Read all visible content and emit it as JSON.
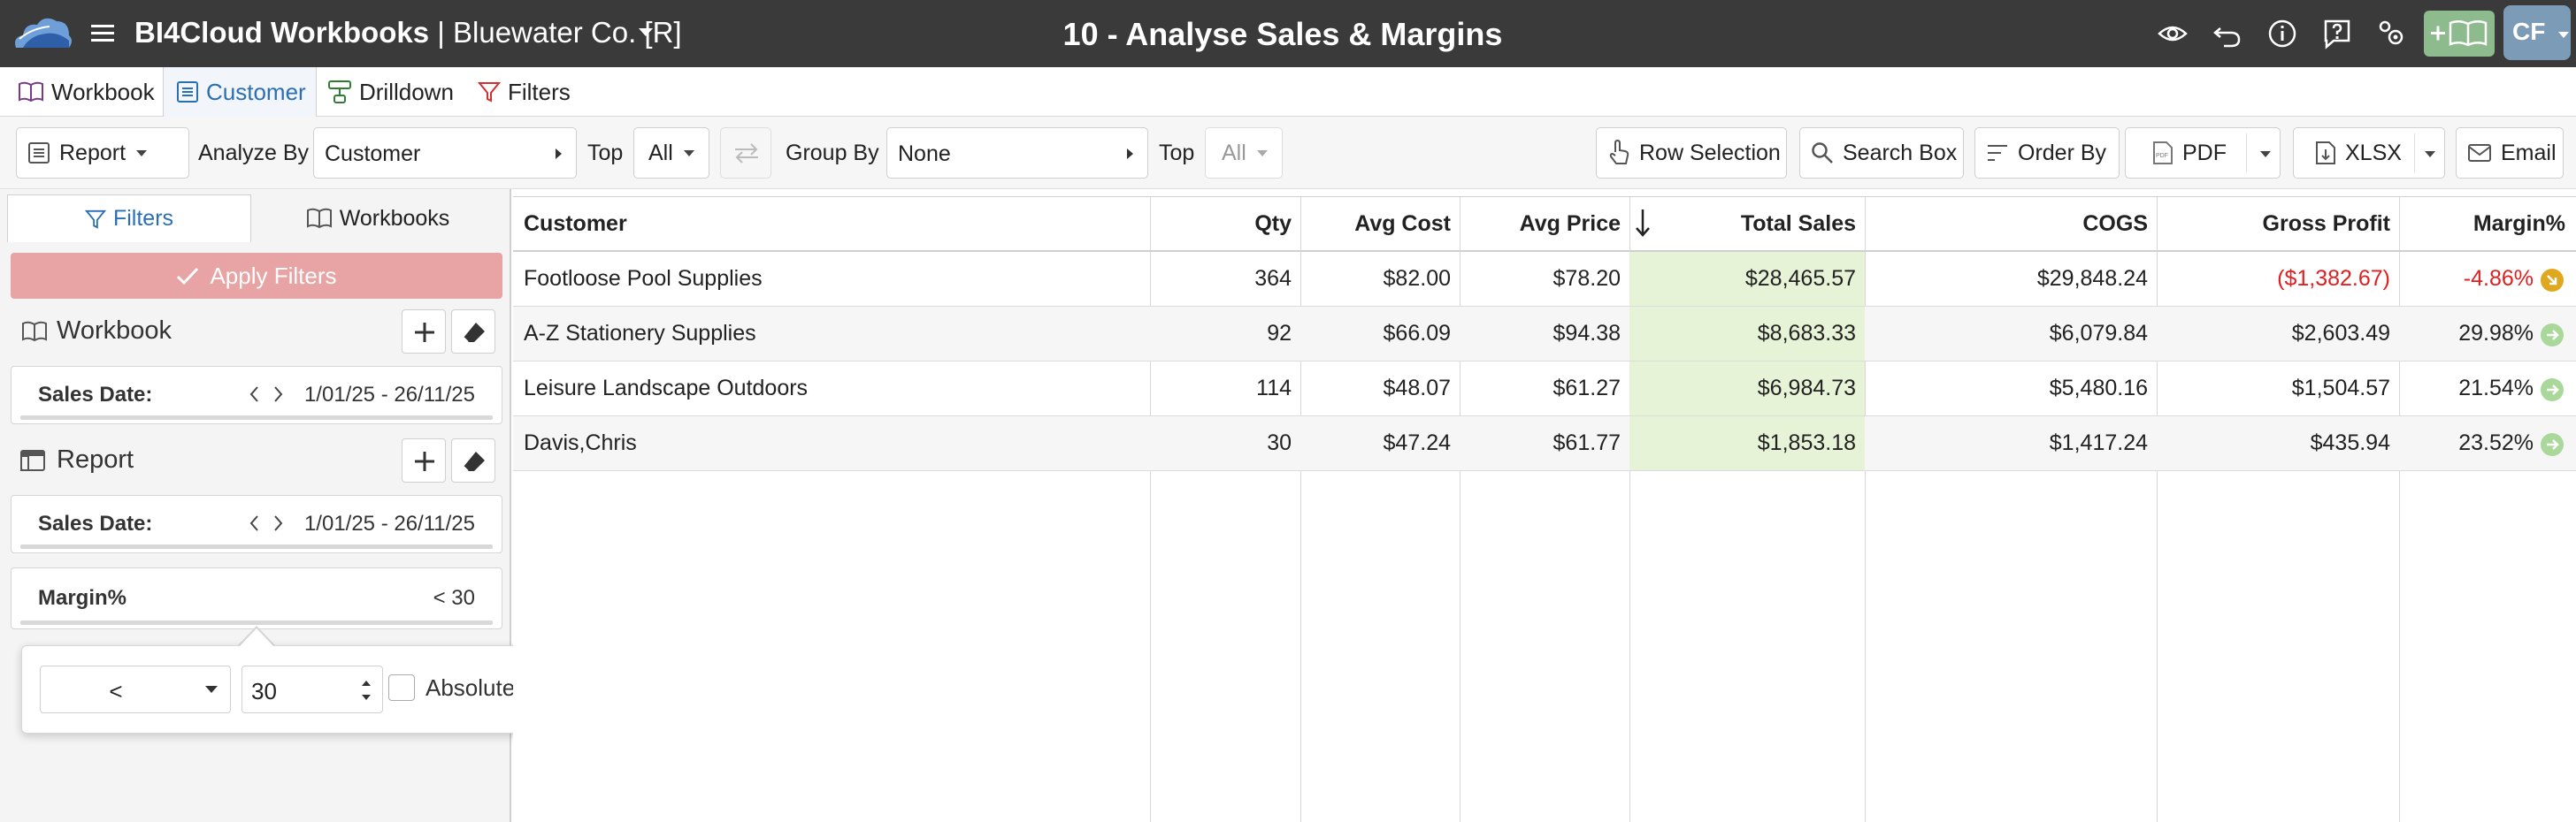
{
  "app": {
    "title": "BI4Cloud Workbooks",
    "separator": " | ",
    "company": "Bluewater Co. [R]",
    "report_title": "10 - Analyse Sales & Margins",
    "user_initials": "CF"
  },
  "tabs": [
    {
      "label": "Workbook",
      "icon": "book-icon"
    },
    {
      "label": "Customer",
      "icon": "list-icon",
      "active": true
    },
    {
      "label": "Drilldown",
      "icon": "drilldown-icon"
    },
    {
      "label": "Filters",
      "icon": "filter-icon"
    }
  ],
  "toolbar": {
    "report_label": "Report",
    "analyze_by_label": "Analyze By",
    "analyze_by_value": "Customer",
    "top_label": "Top",
    "top_value": "All",
    "group_by_label": "Group By",
    "group_by_value": "None",
    "top2_label": "Top",
    "top2_value": "All",
    "row_selection_label": "Row Selection",
    "search_box_label": "Search Box",
    "order_by_label": "Order By",
    "pdf_label": "PDF",
    "xlsx_label": "XLSX",
    "email_label": "Email"
  },
  "left_panel": {
    "tab_filters": "Filters",
    "tab_workbooks": "Workbooks",
    "apply_filters": "Apply Filters",
    "workbook_section": "Workbook",
    "report_section": "Report",
    "workbook_filter": {
      "label": "Sales Date:",
      "value": "1/01/25 - 26/11/25"
    },
    "report_filter": {
      "label": "Sales Date:",
      "value": "1/01/25 - 26/11/25"
    },
    "margin_filter": {
      "label": "Margin%",
      "value": "< 30"
    },
    "popover": {
      "operator": "<",
      "number": "30",
      "absolute_label": "Absolute",
      "absolute_checked": false
    }
  },
  "grid": {
    "columns": [
      "Customer",
      "Qty",
      "Avg Cost",
      "Avg Price",
      "Total Sales",
      "COGS",
      "Gross Profit",
      "Margin%"
    ],
    "sort_column": "Total Sales",
    "sort_direction": "desc",
    "rows": [
      {
        "customer": "Footloose Pool Supplies",
        "qty": "364",
        "avg_cost": "$82.00",
        "avg_price": "$78.20",
        "total_sales": "$28,465.57",
        "cogs": "$29,848.24",
        "gross_profit": "($1,382.67)",
        "margin": "-4.86%",
        "status": "warning",
        "negative": true
      },
      {
        "customer": "A-Z Stationery Supplies",
        "qty": "92",
        "avg_cost": "$66.09",
        "avg_price": "$94.38",
        "total_sales": "$8,683.33",
        "cogs": "$6,079.84",
        "gross_profit": "$2,603.49",
        "margin": "29.98%",
        "status": "ok",
        "negative": false
      },
      {
        "customer": "Leisure Landscape Outdoors",
        "qty": "114",
        "avg_cost": "$48.07",
        "avg_price": "$61.27",
        "total_sales": "$6,984.73",
        "cogs": "$5,480.16",
        "gross_profit": "$1,504.57",
        "margin": "21.54%",
        "status": "ok",
        "negative": false
      },
      {
        "customer": "Davis,Chris",
        "qty": "30",
        "avg_cost": "$47.24",
        "avg_price": "$61.77",
        "total_sales": "$1,853.18",
        "cogs": "$1,417.24",
        "gross_profit": "$435.94",
        "margin": "23.52%",
        "status": "ok",
        "negative": false
      }
    ]
  },
  "colors": {
    "titlebar": "#3a3a3a",
    "accent": "#2a6fb4",
    "apply_button": "#e8a4a4",
    "sales_highlight": "#e7f3d6",
    "negative": "#e02020",
    "warning_dot": "#e0a820",
    "ok_dot": "#a9d89a"
  }
}
